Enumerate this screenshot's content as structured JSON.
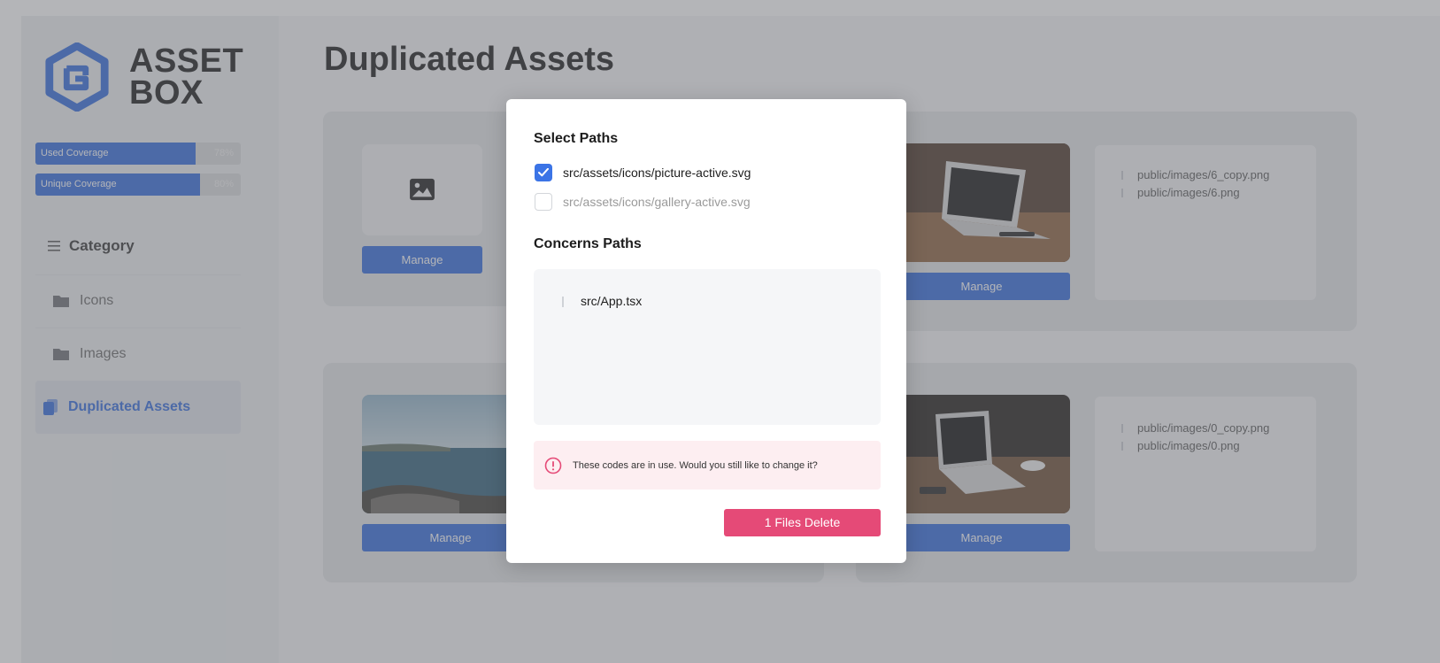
{
  "brand": {
    "line1": "ASSET",
    "line2": "BOX",
    "accent": "#2f68dc"
  },
  "coverage": [
    {
      "label": "Used Coverage",
      "percent_text": "78%",
      "fraction": 0.78
    },
    {
      "label": "Unique Coverage",
      "percent_text": "80%",
      "fraction": 0.8
    }
  ],
  "sidebar": {
    "category_label": "Category",
    "items": [
      {
        "label": "Icons",
        "icon": "folder-icon"
      },
      {
        "label": "Images",
        "icon": "folder-icon"
      },
      {
        "label": "Duplicated Assets",
        "icon": "duplicate-icon",
        "active": true
      }
    ]
  },
  "main": {
    "title": "Duplicated Assets",
    "manage_label": "Manage",
    "cards": [
      {
        "thumb": "image-placeholder-icon",
        "paths": []
      },
      {
        "thumb": "laptop-photo",
        "paths": [
          "public/images/6_copy.png",
          "public/images/6.png"
        ]
      },
      {
        "thumb": "sea-photo",
        "paths": []
      },
      {
        "thumb": "laptop-photo-dark",
        "paths": [
          "public/images/0_copy.png",
          "public/images/0.png"
        ]
      }
    ]
  },
  "modal": {
    "select_paths_title": "Select Paths",
    "options": [
      {
        "path": "src/assets/icons/picture-active.svg",
        "checked": true
      },
      {
        "path": "src/assets/icons/gallery-active.svg",
        "checked": false
      }
    ],
    "concerns_title": "Concerns Paths",
    "concerns": [
      "src/App.tsx"
    ],
    "warning": "These codes are in use. Would you still like to change it?",
    "delete_label": "1 Files Delete",
    "delete_color": "#e54a77"
  }
}
